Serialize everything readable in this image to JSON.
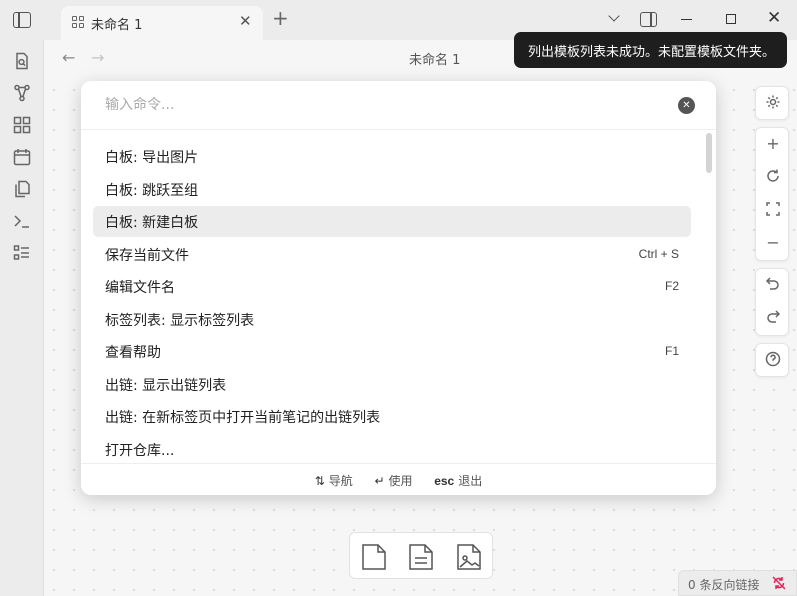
{
  "tab": {
    "title": "未命名 1",
    "close": "✕",
    "new": "+"
  },
  "window": {
    "close": "✕"
  },
  "header": {
    "back": "←",
    "forward": "→",
    "title": "未命名 1"
  },
  "notice": {
    "text": "列出模板列表未成功。未配置模板文件夹。"
  },
  "palette": {
    "placeholder": "输入命令...",
    "clear": "✕",
    "results": [
      {
        "label": "白板: 导出图片",
        "hotkey": ""
      },
      {
        "label": "白板: 跳跃至组",
        "hotkey": ""
      },
      {
        "label": "白板: 新建白板",
        "hotkey": "",
        "selected": true
      },
      {
        "label": "保存当前文件",
        "hotkey": "Ctrl + S"
      },
      {
        "label": "编辑文件名",
        "hotkey": "F2"
      },
      {
        "label": "标签列表: 显示标签列表",
        "hotkey": ""
      },
      {
        "label": "查看帮助",
        "hotkey": "F1"
      },
      {
        "label": "出链: 显示出链列表",
        "hotkey": ""
      },
      {
        "label": "出链: 在新标签页中打开当前笔记的出链列表",
        "hotkey": ""
      },
      {
        "label": "打开仓库...",
        "hotkey": ""
      }
    ],
    "footer": {
      "navigate_key": "⇅",
      "navigate": "导航",
      "use_key": "↵",
      "use": "使用",
      "esc_key": "esc",
      "esc": "退出"
    }
  },
  "canvas_controls": {
    "zoom_in": "+",
    "zoom_out": "−",
    "help": "?"
  },
  "status": {
    "backlinks": "0 条反向链接"
  },
  "colors": {
    "notice_bg": "#1e1e1e",
    "selected_row": "#ececec",
    "sync_off": "#e0245e"
  }
}
